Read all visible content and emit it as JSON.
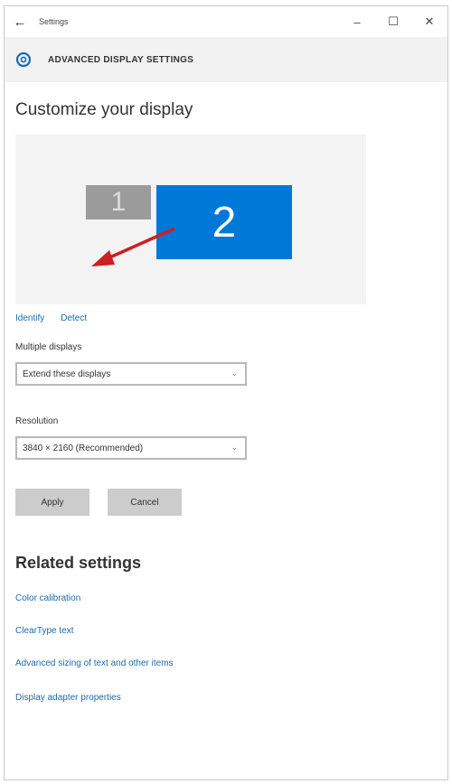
{
  "window": {
    "title": "Settings",
    "back_glyph": "←",
    "controls": {
      "minimize": "–",
      "maximize": "☐",
      "close": "✕"
    }
  },
  "header": {
    "icon": "gear-icon",
    "title": "ADVANCED DISPLAY SETTINGS"
  },
  "page": {
    "title": "Customize your display"
  },
  "arrangement": {
    "monitors": [
      {
        "label": "1",
        "color": "#9b9b9b"
      },
      {
        "label": "2",
        "color": "#0078d7"
      }
    ],
    "arrow_color": "#cc1f1f"
  },
  "links": {
    "identify": "Identify",
    "detect": "Detect"
  },
  "multiple_displays": {
    "label": "Multiple displays",
    "value": "Extend these displays"
  },
  "resolution": {
    "label": "Resolution",
    "value": "3840 × 2160 (Recommended)"
  },
  "buttons": {
    "apply": "Apply",
    "cancel": "Cancel"
  },
  "related": {
    "title": "Related settings",
    "items": [
      "Color calibration",
      "ClearType text",
      "Advanced sizing of text and other items",
      "Display adapter properties"
    ]
  },
  "colors": {
    "accent": "#0078d7",
    "link": "#1a6bb0"
  }
}
